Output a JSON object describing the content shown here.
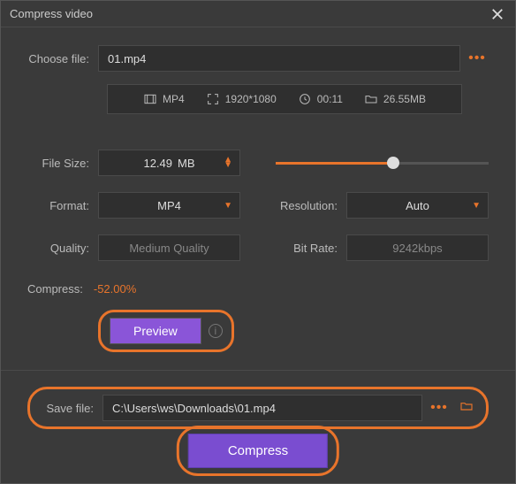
{
  "titlebar": {
    "title": "Compress video"
  },
  "choose": {
    "label": "Choose file:",
    "value": "01.mp4"
  },
  "meta": {
    "format": "MP4",
    "resolution": "1920*1080",
    "duration": "00:11",
    "size": "26.55MB"
  },
  "settings": {
    "filesize": {
      "label": "File Size:",
      "value": "12.49",
      "unit": "MB"
    },
    "format": {
      "label": "Format:",
      "value": "MP4"
    },
    "quality": {
      "label": "Quality:",
      "value": "Medium Quality"
    },
    "resolution": {
      "label": "Resolution:",
      "value": "Auto"
    },
    "bitrate": {
      "label": "Bit Rate:",
      "value": "9242kbps"
    }
  },
  "compress": {
    "label": "Compress:",
    "value": "-52.00%"
  },
  "preview": {
    "label": "Preview"
  },
  "savefile": {
    "label": "Save file:",
    "value": "C:\\Users\\ws\\Downloads\\01.mp4"
  },
  "action": {
    "label": "Compress"
  },
  "colors": {
    "accent_orange": "#e8742b",
    "accent_purple": "#8a55d8"
  }
}
